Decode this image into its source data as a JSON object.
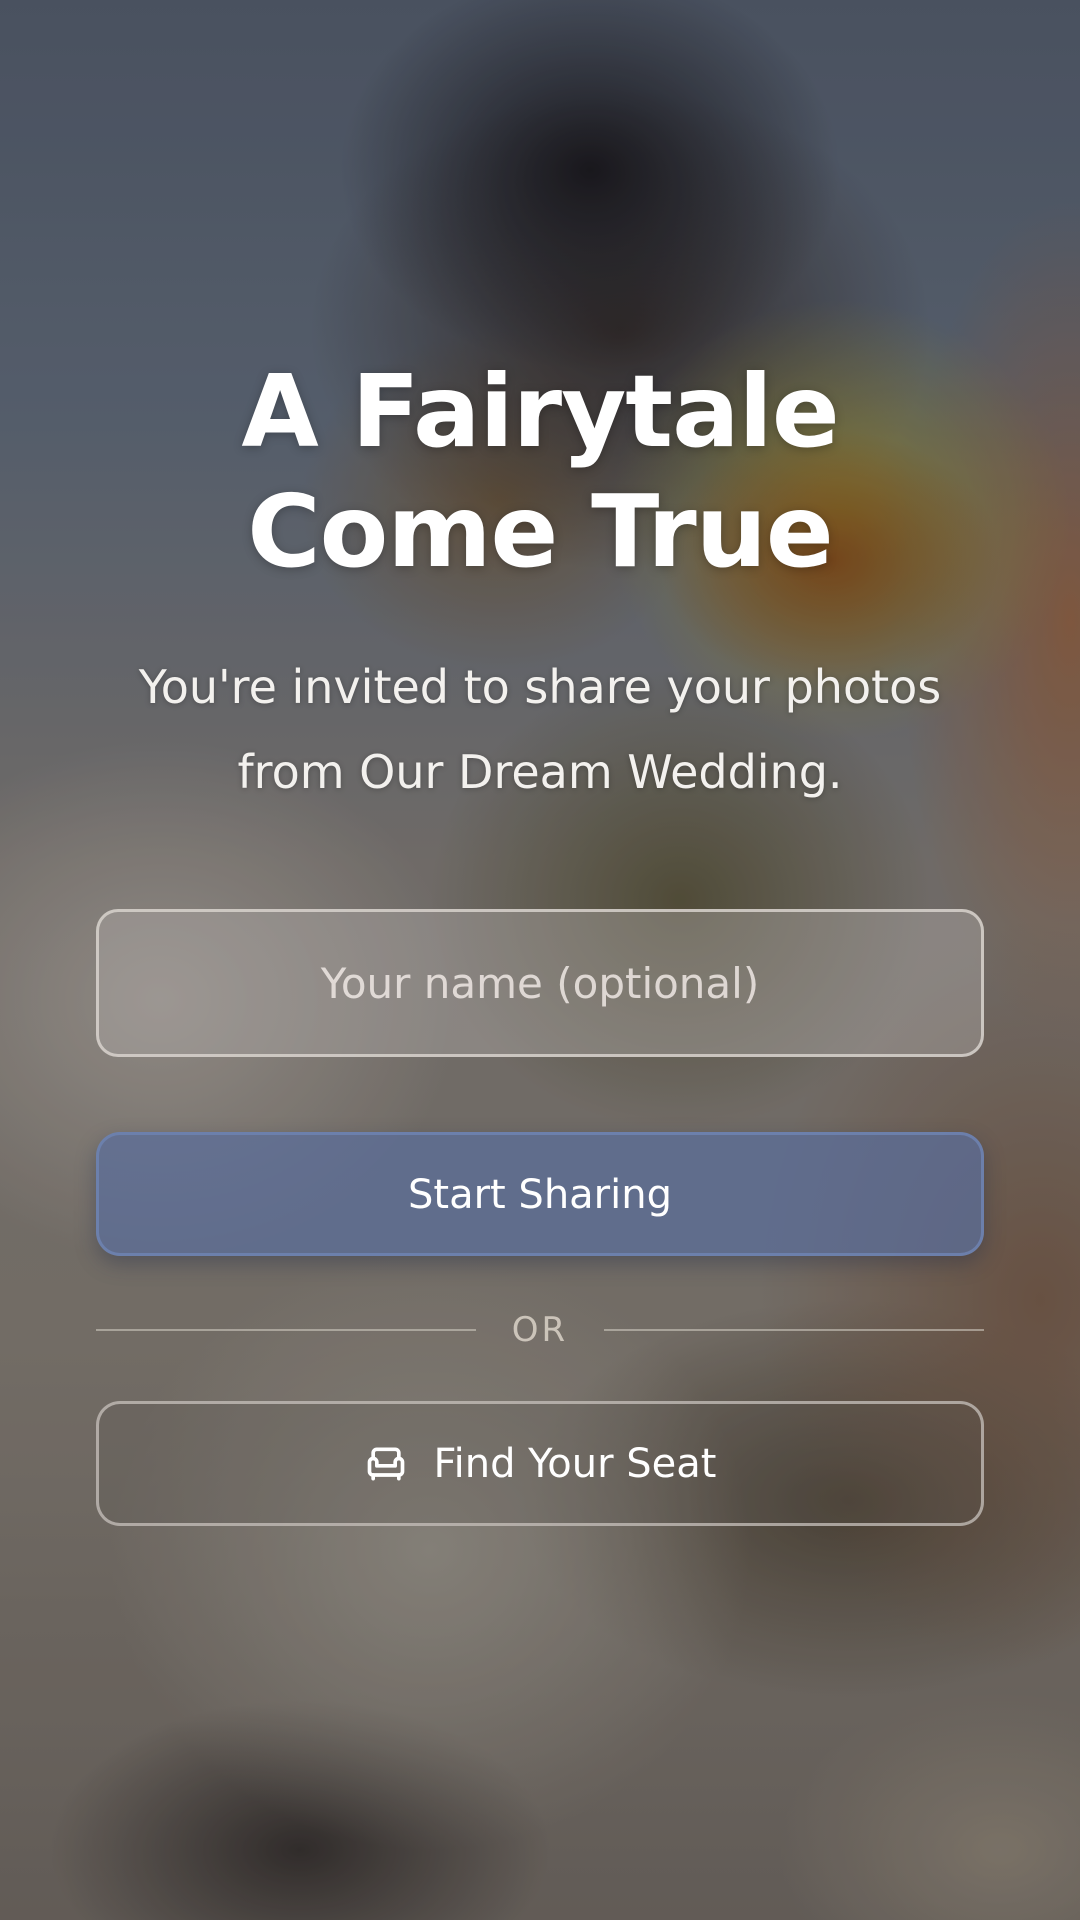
{
  "hero": {
    "title": "A Fairytale Come True",
    "subtitle": "You're invited to share your photos from Our Dream Wedding."
  },
  "form": {
    "name_placeholder": "Your name (optional)",
    "name_value": "",
    "start_label": "Start Sharing"
  },
  "divider": {
    "label": "OR"
  },
  "seat": {
    "label": "Find Your Seat",
    "icon": "armchair-icon"
  },
  "colors": {
    "primary_button": "#5a6e9b",
    "text": "#ffffff"
  }
}
